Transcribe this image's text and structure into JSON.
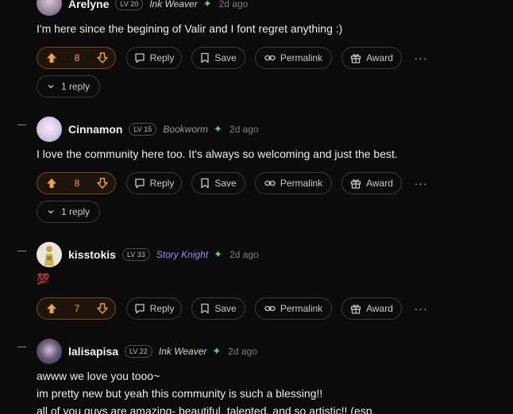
{
  "colors": {
    "background": "#0b0b0c",
    "vote_accent": "#f0a43a",
    "sparkle": "#4cd98a",
    "story_knight": "#9b8cf5"
  },
  "actions": {
    "reply": "Reply",
    "save": "Save",
    "permalink": "Permalink",
    "award": "Award",
    "more": "···"
  },
  "comments": [
    {
      "username": "Arelyne",
      "level": "LV 20",
      "flair": "Ink Weaver",
      "flair_color": "#d6d6da",
      "time": "2d ago",
      "text": "I'm here since the begining of Valir and I font regret anything :)",
      "votes": "8",
      "replies_label": "1 reply"
    },
    {
      "username": "Cinnamon",
      "level": "LV 15",
      "flair": "Bookworm",
      "flair_color": "#9a9aa0",
      "time": "2d ago",
      "text": "I love the community here too. It's always so welcoming and just the best.",
      "votes": "8",
      "replies_label": "1 reply"
    },
    {
      "username": "kisstokis",
      "level": "LV 33",
      "flair": "Story Knight",
      "flair_color": "#9b8cf5",
      "time": "2d ago",
      "text": "💯",
      "votes": "7"
    },
    {
      "username": "lalisapisa",
      "level": "LV 22",
      "flair": "Ink Weaver",
      "flair_color": "#d6d6da",
      "time": "2d ago",
      "lines": [
        "awww we love you tooo~",
        "im pretty new but yeah this community is such a blessing!!",
        "all of you guys are amazing- beautiful, talented, and so artistic!! (esp."
      ]
    }
  ]
}
